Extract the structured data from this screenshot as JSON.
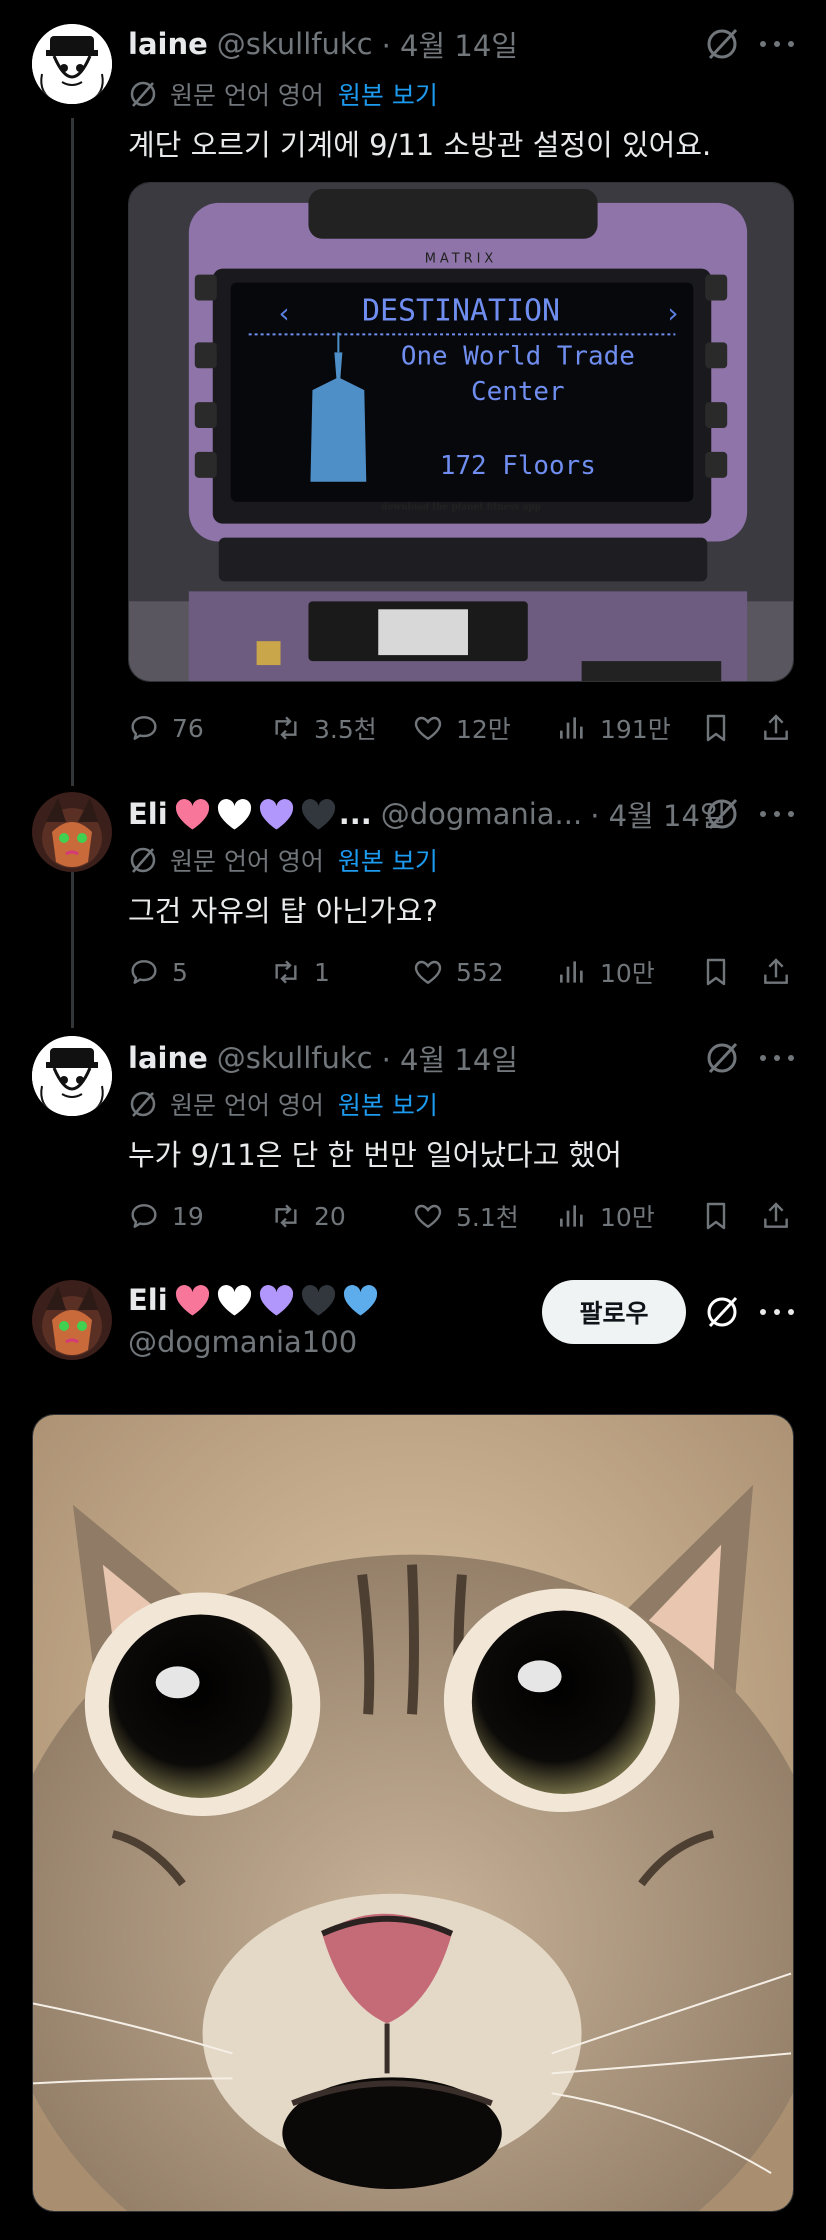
{
  "tweets": [
    {
      "name": "laine",
      "handle": "@skullfukc",
      "date": "· 4월 14일",
      "translate_label": "원문 언어 영어",
      "translate_link": "원본 보기",
      "text": "계단 오르기 기계에 9/11 소방관 설정이 있어요.",
      "media": {
        "brand": "MATRIX",
        "screen_title": "DESTINATION",
        "screen_line1": "One World Trade",
        "screen_line2": "Center",
        "screen_floors": "172 Floors",
        "footer": "download the planet fitness app"
      },
      "replies": "76",
      "retweets": "3.5천",
      "likes": "12만",
      "views": "191만"
    },
    {
      "name": "Eli",
      "name_suffix": "...",
      "handle": "@dogmania...",
      "date": "· 4월 14일",
      "translate_label": "원문 언어 영어",
      "translate_link": "원본 보기",
      "text": "그건 자유의 탑 아닌가요?",
      "replies": "5",
      "retweets": "1",
      "likes": "552",
      "views": "10만"
    },
    {
      "name": "laine",
      "handle": "@skullfukc",
      "date": "· 4월 14일",
      "translate_label": "원문 언어 영어",
      "translate_link": "원본 보기",
      "text": "누가 9/11은 단 한 번만 일어났다고 했어",
      "replies": "19",
      "retweets": "20",
      "likes": "5.1천",
      "views": "10만"
    }
  ],
  "main_post": {
    "name": "Eli",
    "handle": "@dogmania100",
    "follow_label": "팔로우"
  },
  "colors": {
    "background": "#000000",
    "muted": "#71767b",
    "link": "#1d9bf0",
    "heart_pink": "#f7769a",
    "heart_white": "#ffffff",
    "heart_purple": "#b197fc",
    "heart_black": "#31373d",
    "heart_blue": "#5dadec"
  }
}
